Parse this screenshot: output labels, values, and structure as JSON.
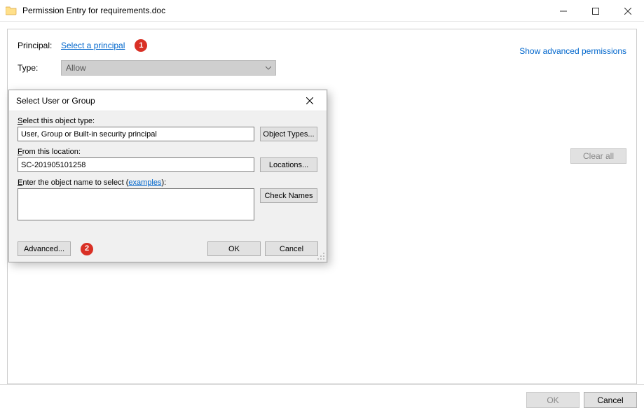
{
  "window": {
    "title": "Permission Entry for requirements.doc"
  },
  "panel": {
    "principal_label": "Principal:",
    "principal_link": "Select a principal",
    "type_label": "Type:",
    "type_value": "Allow",
    "advanced_link": "Show advanced permissions",
    "clear_all": "Clear all"
  },
  "annotations": {
    "one": "1",
    "two": "2"
  },
  "buttons": {
    "ok": "OK",
    "cancel": "Cancel"
  },
  "dialog": {
    "title": "Select User or Group",
    "object_type_label": "Select this object type:",
    "object_type_value": "User, Group or Built-in security principal",
    "object_types_btn": "Object Types...",
    "location_label": "From this location:",
    "location_value": "SC-201905101258",
    "locations_btn": "Locations...",
    "enter_name_prefix": "Enter the object name to select (",
    "examples_link": "examples",
    "enter_name_suffix": "):",
    "check_names_btn": "Check Names",
    "advanced_btn": "Advanced...",
    "object_name_value": ""
  }
}
